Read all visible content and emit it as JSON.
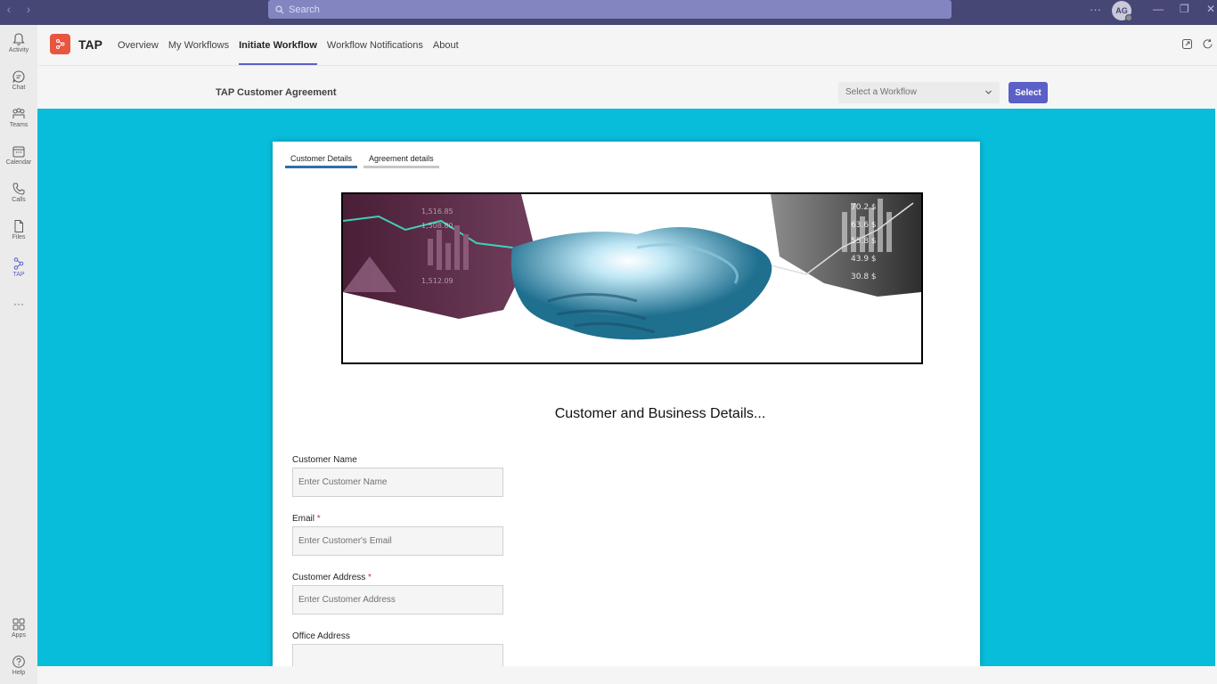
{
  "titlebar": {
    "search_placeholder": "Search",
    "more": "···",
    "avatar_initials": "AG"
  },
  "rail": {
    "items": [
      {
        "label": "Activity"
      },
      {
        "label": "Chat"
      },
      {
        "label": "Teams"
      },
      {
        "label": "Calendar"
      },
      {
        "label": "Calls"
      },
      {
        "label": "Files"
      },
      {
        "label": "TAP"
      }
    ],
    "more": "···",
    "apps": "Apps",
    "help": "Help"
  },
  "app": {
    "name": "TAP",
    "tabs": [
      {
        "label": "Overview"
      },
      {
        "label": "My Workflows"
      },
      {
        "label": "Initiate Workflow",
        "active": true
      },
      {
        "label": "Workflow Notifications"
      },
      {
        "label": "About"
      }
    ]
  },
  "workflow_bar": {
    "title": "TAP Customer Agreement",
    "select_placeholder": "Select a Workflow",
    "select_button": "Select"
  },
  "form": {
    "tabs": [
      {
        "label": "Customer Details",
        "active": true
      },
      {
        "label": "Agreement details"
      }
    ],
    "banner_numbers": [
      "70.2 $",
      "63.6 $",
      "55.8 $",
      "43.9 $",
      "30.8 $",
      "1,516.85",
      "1,508.80",
      "1,512.09"
    ],
    "heading": "Customer and Business Details...",
    "fields": [
      {
        "label": "Customer Name",
        "required": false,
        "placeholder": "Enter Customer Name"
      },
      {
        "label": "Email",
        "required": true,
        "placeholder": "Enter Customer's Email"
      },
      {
        "label": "Customer Address",
        "required": true,
        "placeholder": "Enter Customer Address"
      },
      {
        "label": "Office Address",
        "required": false,
        "placeholder": ""
      }
    ],
    "required_marker": "*"
  },
  "colors": {
    "titlebar": "#464775",
    "accent": "#5b5fc7",
    "canvas": "#08bdda",
    "app_logo": "#e9553f"
  }
}
